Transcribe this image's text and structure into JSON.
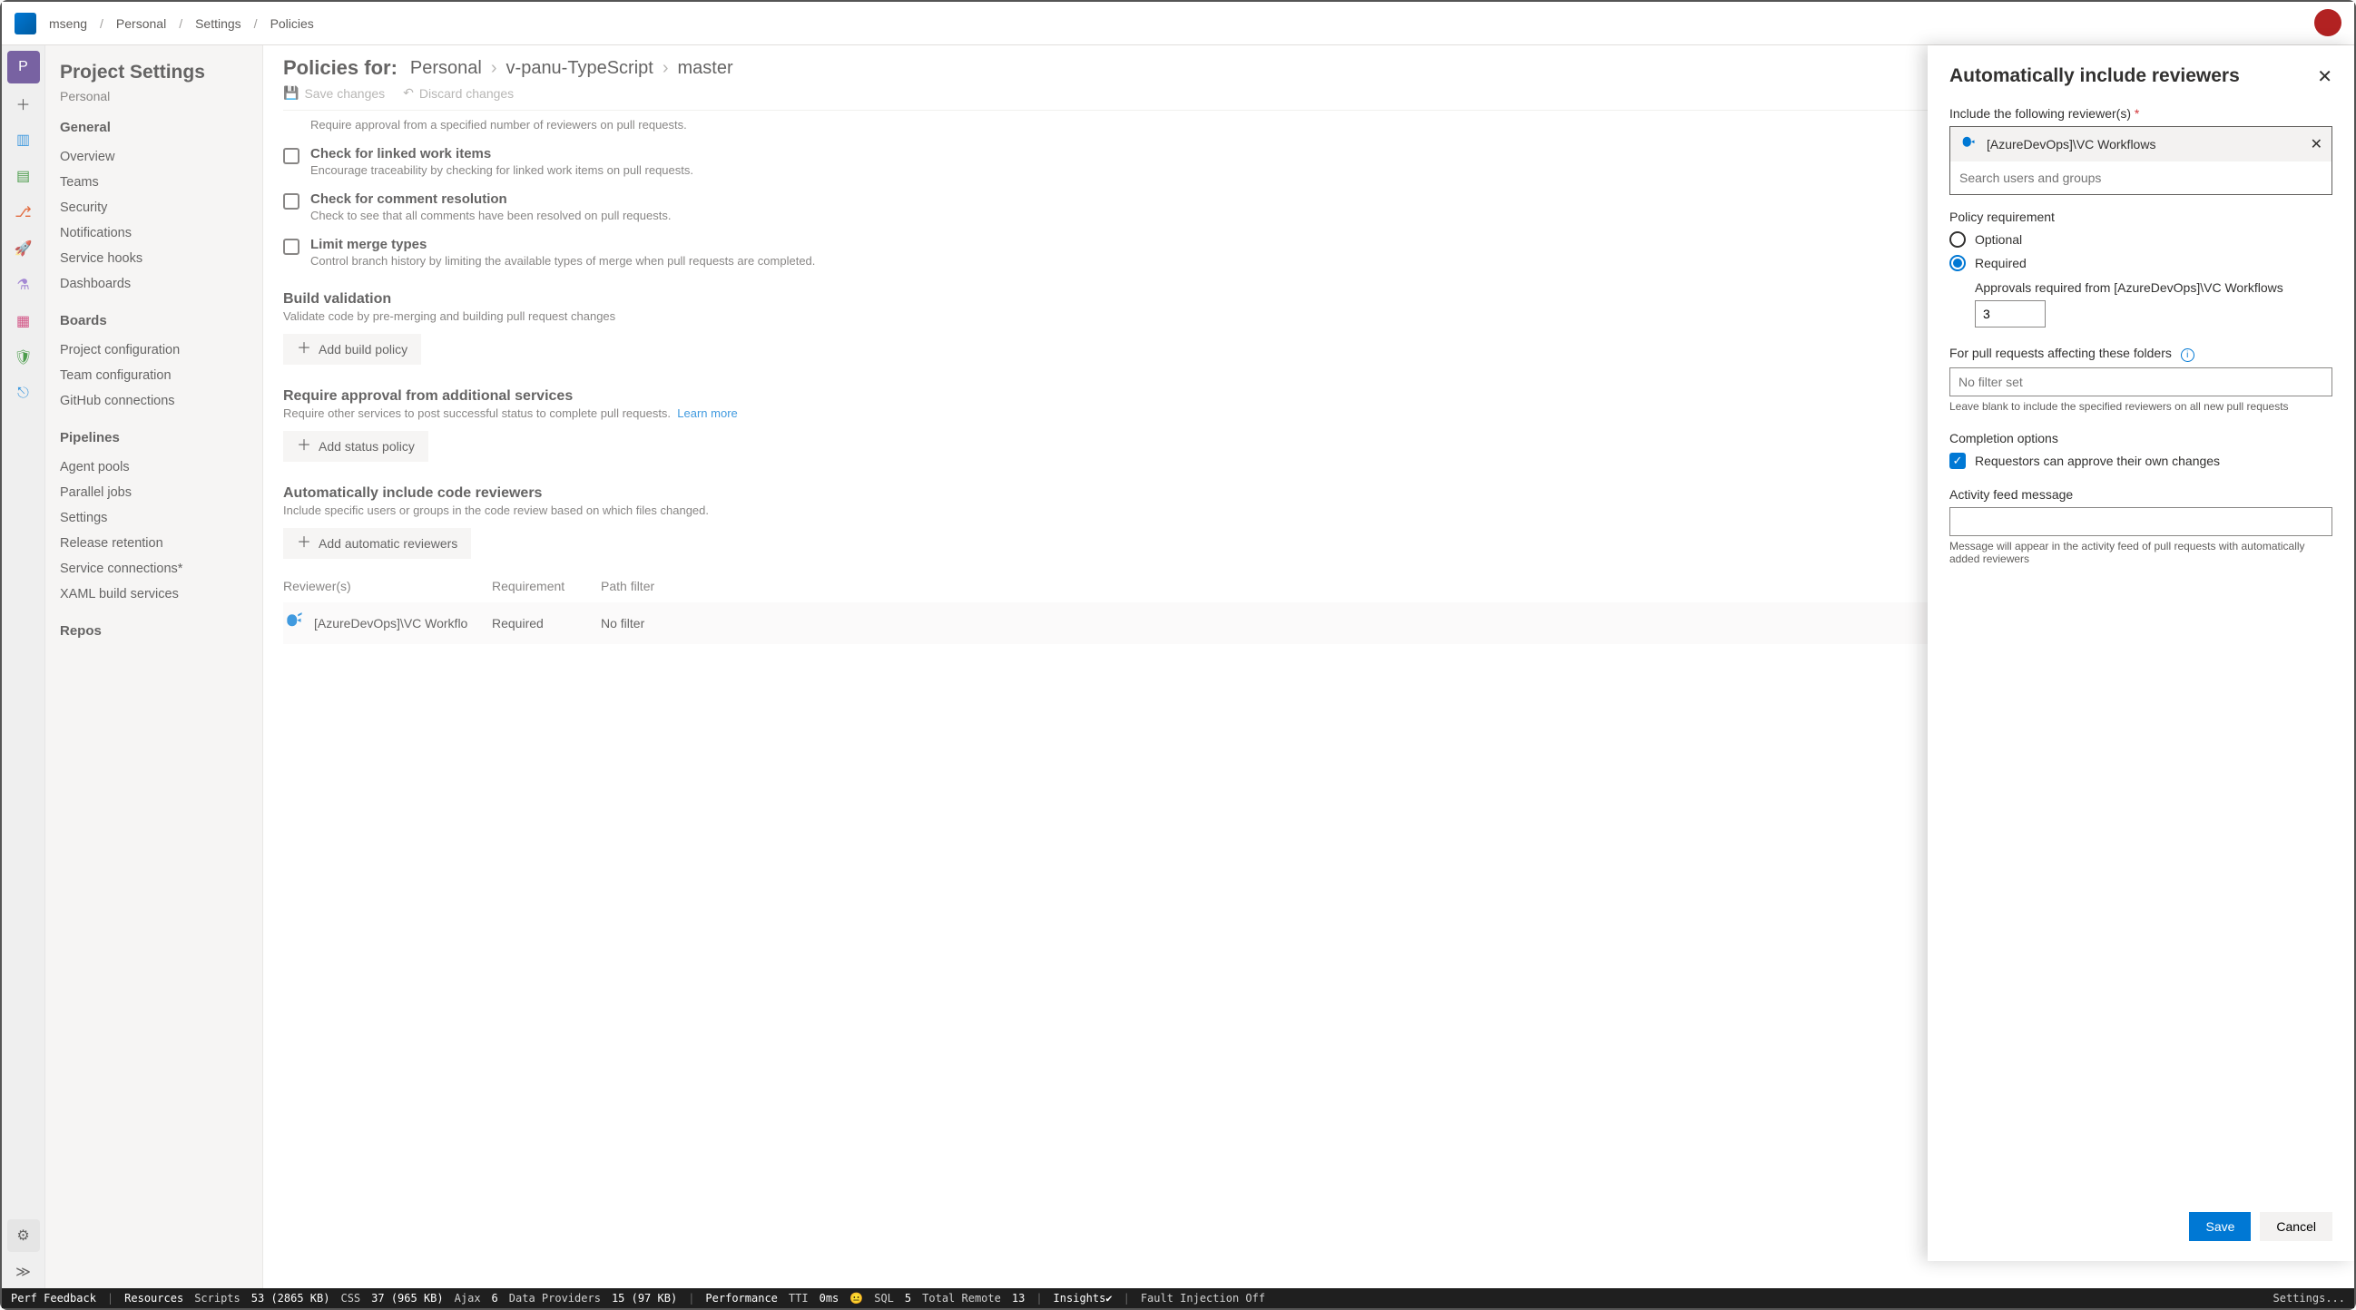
{
  "breadcrumb": {
    "org": "mseng",
    "project": "Personal",
    "section": "Settings",
    "page": "Policies"
  },
  "sidebar": {
    "title": "Project Settings",
    "project": "Personal",
    "groups": [
      {
        "label": "General",
        "items": [
          "Overview",
          "Teams",
          "Security",
          "Notifications",
          "Service hooks",
          "Dashboards"
        ]
      },
      {
        "label": "Boards",
        "items": [
          "Project configuration",
          "Team configuration",
          "GitHub connections"
        ]
      },
      {
        "label": "Pipelines",
        "items": [
          "Agent pools",
          "Parallel jobs",
          "Settings",
          "Release retention",
          "Service connections*",
          "XAML build services"
        ]
      },
      {
        "label": "Repos",
        "items": []
      }
    ]
  },
  "main": {
    "policies_for": "Policies for:",
    "path": [
      "Personal",
      "v-panu-TypeScript",
      "master"
    ],
    "save": "Save changes",
    "discard": "Discard changes",
    "top_sub": "Require approval from a specified number of reviewers on pull requests.",
    "checks": [
      {
        "t": "Check for linked work items",
        "s": "Encourage traceability by checking for linked work items on pull requests."
      },
      {
        "t": "Check for comment resolution",
        "s": "Check to see that all comments have been resolved on pull requests."
      },
      {
        "t": "Limit merge types",
        "s": "Control branch history by limiting the available types of merge when pull requests are completed."
      }
    ],
    "build": {
      "h": "Build validation",
      "s": "Validate code by pre-merging and building pull request changes",
      "btn": "Add build policy"
    },
    "status": {
      "h": "Require approval from additional services",
      "s": "Require other services to post successful status to complete pull requests.",
      "learn": "Learn more",
      "btn": "Add status policy"
    },
    "reviewers": {
      "h": "Automatically include code reviewers",
      "s": "Include specific users or groups in the code review based on which files changed.",
      "btn": "Add automatic reviewers",
      "cols": {
        "c1": "Reviewer(s)",
        "c2": "Requirement",
        "c3": "Path filter"
      },
      "row": {
        "name": "[AzureDevOps]\\VC Workflo",
        "req": "Required",
        "path": "No filter"
      }
    }
  },
  "panel": {
    "title": "Automatically include reviewers",
    "include_lbl": "Include the following reviewer(s)",
    "chip": "[AzureDevOps]\\VC Workflows",
    "search_ph": "Search users and groups",
    "policy_req": "Policy requirement",
    "optional": "Optional",
    "required": "Required",
    "approvals_lbl": "Approvals required from [AzureDevOps]\\VC Workflows",
    "approvals_val": "3",
    "folders_lbl": "For pull requests affecting these folders",
    "folders_ph": "No filter set",
    "folders_help": "Leave blank to include the specified reviewers on all new pull requests",
    "completion_lbl": "Completion options",
    "completion_opt": "Requestors can approve their own changes",
    "activity_lbl": "Activity feed message",
    "activity_help": "Message will appear in the activity feed of pull requests with automatically added reviewers",
    "save": "Save",
    "cancel": "Cancel"
  },
  "statusbar": {
    "perf": "Perf Feedback",
    "resources": "Resources",
    "scripts_lbl": "Scripts",
    "scripts": "53 (2865 KB)",
    "css_lbl": "CSS",
    "css": "37 (965 KB)",
    "ajax_lbl": "Ajax",
    "ajax": "6",
    "dp_lbl": "Data Providers",
    "dp": "15 (97 KB)",
    "performance": "Performance",
    "tti_lbl": "TTI",
    "tti": "0ms",
    "sql_lbl": "SQL",
    "sql": "5",
    "tr_lbl": "Total Remote",
    "tr": "13",
    "insights": "Insights✔",
    "fault": "Fault Injection Off",
    "settings": "Settings..."
  }
}
